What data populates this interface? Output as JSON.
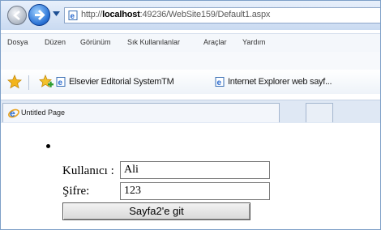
{
  "browser": {
    "address": {
      "url_prefix": "http://",
      "url_host": "localhost",
      "url_rest": ":49236/WebSite159/Default1.aspx"
    },
    "menu": [
      "Dosya",
      "Düzen",
      "Görünüm",
      "Sık Kullanılanlar",
      "Araçlar",
      "Yardım"
    ],
    "favorites": [
      {
        "label": "Elsevier Editorial SystemTM"
      },
      {
        "label": "Internet Explorer web sayf..."
      }
    ],
    "tab": {
      "label": "Untitled Page"
    }
  },
  "page": {
    "username_label": "Kullanıcı :",
    "username_value": "Ali",
    "password_label": "Şifre:",
    "password_value": "123",
    "submit_label": "Sayfa2'e git"
  },
  "colors": {
    "chrome_blue": "#c9daf1",
    "border_blue": "#7ea0c8",
    "forward_button": "#2d75d6"
  }
}
